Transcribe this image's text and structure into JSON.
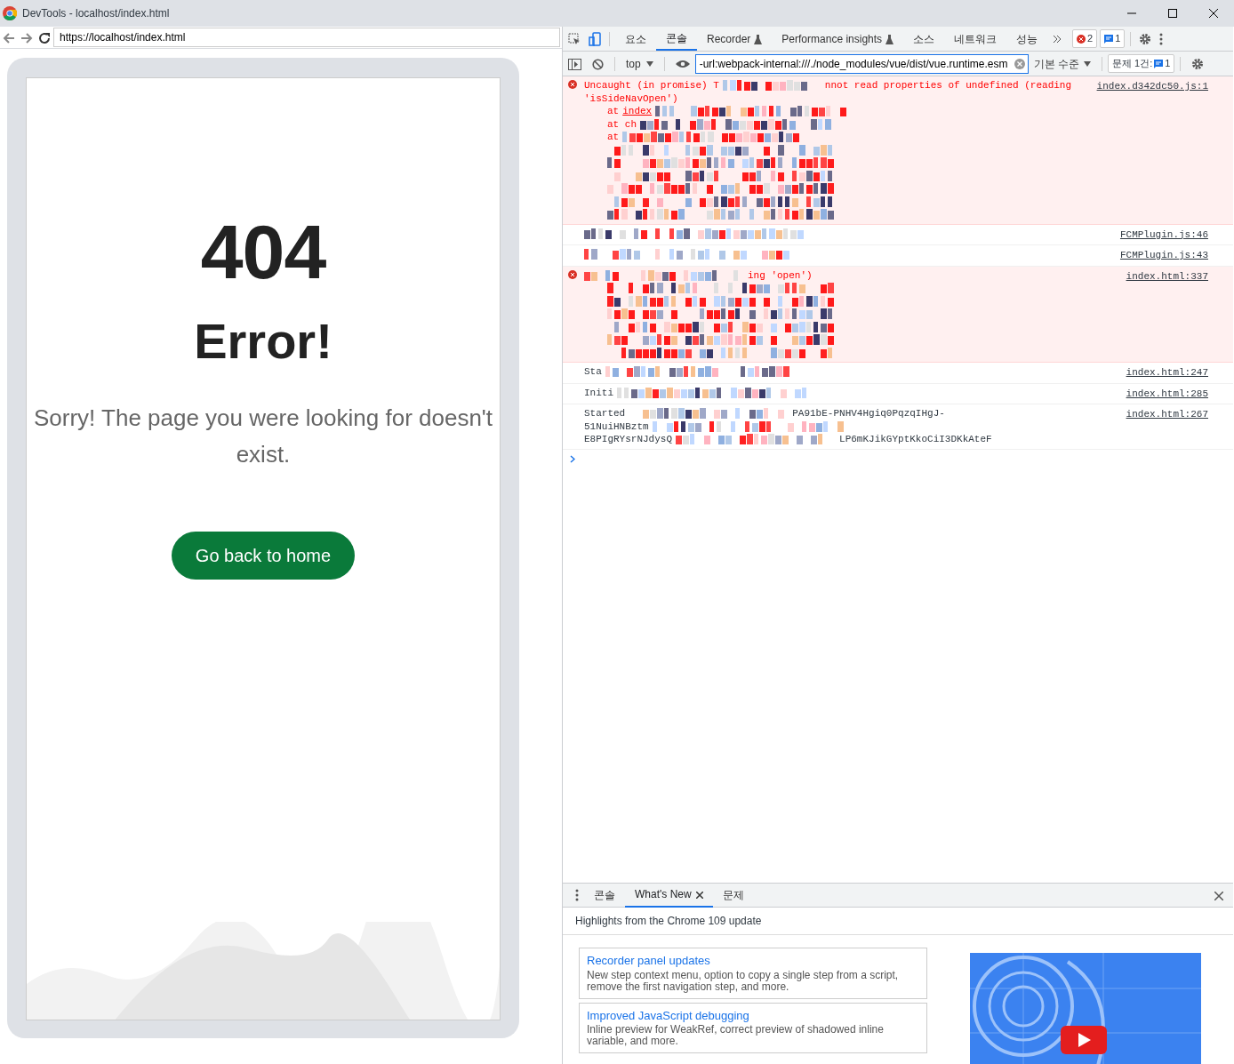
{
  "window": {
    "title": "DevTools - localhost/index.html"
  },
  "browser": {
    "url": "https://localhost/index.html"
  },
  "page": {
    "code": "404",
    "heading": "Error!",
    "message": "Sorry! The page you were looking for doesn't exist.",
    "button": "Go back to home"
  },
  "devtools": {
    "tabs": [
      {
        "label": "요소",
        "selected": false,
        "experimental": false
      },
      {
        "label": "콘솔",
        "selected": true,
        "experimental": false
      },
      {
        "label": "Recorder",
        "selected": false,
        "experimental": true
      },
      {
        "label": "Performance insights",
        "selected": false,
        "experimental": true
      },
      {
        "label": "소스",
        "selected": false,
        "experimental": false
      },
      {
        "label": "네트워크",
        "selected": false,
        "experimental": false
      },
      {
        "label": "성능",
        "selected": false,
        "experimental": false
      }
    ],
    "error_count": "2",
    "message_count": "1",
    "console_toolbar": {
      "context": "top",
      "filter": "-url:webpack-internal:///./node_modules/vue/dist/vue.runtime.esm",
      "level": "기본 수준",
      "issues": "문제 1건:",
      "issues_count": "1"
    },
    "messages": [
      {
        "kind": "error",
        "source": "index.d342dc50.js:1",
        "lines": [
          {
            "indented": false,
            "pieces": [
              {
                "kind": "text",
                "text": "Uncaught (in promise) T"
              },
              {
                "kind": "mosaic"
              },
              {
                "kind": "text",
                "text": "nnot read properties of undefined (reading"
              }
            ]
          },
          {
            "indented": false,
            "pieces": [
              {
                "kind": "text",
                "text": "'isSideNavOpen')"
              }
            ]
          },
          {
            "indented": true,
            "pieces": [
              {
                "kind": "text",
                "text": "at"
              },
              {
                "kind": "link",
                "text": "index"
              },
              {
                "kind": "mosaic"
              }
            ]
          },
          {
            "indented": true,
            "pieces": [
              {
                "kind": "text",
                "text": "at ch"
              },
              {
                "kind": "mosaic"
              }
            ]
          },
          {
            "indented": true,
            "pieces": [
              {
                "kind": "text",
                "text": "at"
              },
              {
                "kind": "mosaic"
              }
            ]
          },
          {
            "indented": true,
            "pieces": [
              {
                "kind": "mosaic"
              }
            ]
          },
          {
            "indented": true,
            "pieces": [
              {
                "kind": "mosaic"
              }
            ]
          },
          {
            "indented": true,
            "pieces": [
              {
                "kind": "mosaic"
              }
            ]
          },
          {
            "indented": true,
            "pieces": [
              {
                "kind": "mosaic"
              }
            ]
          },
          {
            "indented": true,
            "pieces": [
              {
                "kind": "mosaic"
              }
            ]
          },
          {
            "indented": true,
            "pieces": [
              {
                "kind": "mosaic"
              }
            ]
          }
        ]
      },
      {
        "kind": "info",
        "source": "FCMPlugin.js:46",
        "lines": [
          {
            "indented": false,
            "pieces": [
              {
                "kind": "mosaic"
              }
            ]
          }
        ]
      },
      {
        "kind": "info",
        "source": "FCMPlugin.js:43",
        "lines": [
          {
            "indented": false,
            "pieces": [
              {
                "kind": "mosaic"
              }
            ]
          }
        ]
      },
      {
        "kind": "error",
        "source": "index.html:337",
        "lines": [
          {
            "indented": false,
            "pieces": [
              {
                "kind": "mosaic"
              },
              {
                "kind": "text",
                "text": "ing 'open')"
              }
            ]
          },
          {
            "indented": true,
            "pieces": [
              {
                "kind": "mosaic"
              }
            ]
          },
          {
            "indented": true,
            "pieces": [
              {
                "kind": "mosaic"
              }
            ]
          },
          {
            "indented": true,
            "pieces": [
              {
                "kind": "mosaic"
              }
            ]
          },
          {
            "indented": true,
            "pieces": [
              {
                "kind": "mosaic"
              }
            ]
          },
          {
            "indented": true,
            "pieces": [
              {
                "kind": "mosaic"
              }
            ]
          },
          {
            "indented": true,
            "pieces": [
              {
                "kind": "mosaic"
              }
            ]
          }
        ]
      },
      {
        "kind": "info",
        "source": "index.html:247",
        "lines": [
          {
            "indented": false,
            "pieces": [
              {
                "kind": "text",
                "text": "Sta"
              },
              {
                "kind": "mosaic"
              }
            ]
          }
        ]
      },
      {
        "kind": "info",
        "source": "index.html:285",
        "lines": [
          {
            "indented": false,
            "pieces": [
              {
                "kind": "text",
                "text": "Initi"
              },
              {
                "kind": "mosaic"
              }
            ]
          }
        ]
      },
      {
        "kind": "info",
        "source": "index.html:267",
        "lines": [
          {
            "indented": false,
            "pieces": [
              {
                "kind": "text",
                "text": "Started"
              },
              {
                "kind": "mosaic"
              },
              {
                "kind": "text",
                "text": "PA91bE-PNHV4Hgiq0PqzqIHgJ-"
              }
            ]
          },
          {
            "indented": false,
            "pieces": [
              {
                "kind": "text",
                "text": "51NuiHNBztm"
              },
              {
                "kind": "mosaic"
              }
            ]
          },
          {
            "indented": false,
            "pieces": [
              {
                "kind": "text",
                "text": "E8PIgRYsrNJdysQ"
              },
              {
                "kind": "mosaic"
              },
              {
                "kind": "text",
                "text": "LP6mKJikGYptKkoCiI3DKkAteF"
              }
            ]
          }
        ]
      }
    ],
    "drawer": {
      "tabs": [
        {
          "label": "콘솔",
          "selected": false,
          "closable": false
        },
        {
          "label": "What's New",
          "selected": true,
          "closable": true
        },
        {
          "label": "문제",
          "selected": false,
          "closable": false
        }
      ],
      "headline": "Highlights from the Chrome 109 update",
      "cards": [
        {
          "title": "Recorder panel updates",
          "body": "New step context menu, option to copy a single step from a script, remove the first navigation step, and more."
        },
        {
          "title": "Improved JavaScript debugging",
          "body": "Inline preview for WeakRef, correct preview of shadowed inline variable, and more."
        }
      ]
    }
  }
}
